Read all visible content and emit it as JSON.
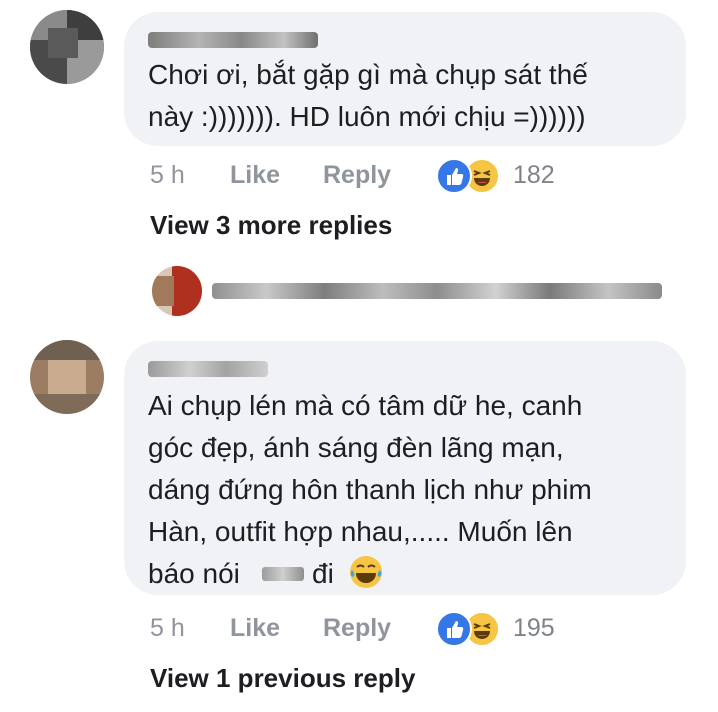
{
  "comment1": {
    "text_line1": "Chơi ơi, bắt gặp gì mà chụp sát thế",
    "text_line2": "này :))))))). HD luôn mới chịu =))))))",
    "time": "5 h",
    "like_label": "Like",
    "reply_label": "Reply",
    "reaction_count": "182",
    "view_replies": "View 3 more replies"
  },
  "comment2": {
    "text_line1": "Ai chụp lén mà có tâm dữ he, canh",
    "text_line2": "góc đẹp, ánh sáng đèn lãng mạn,",
    "text_line3": "dáng đứng hôn thanh lịch như phim",
    "text_line4": "Hàn, outfit hợp nhau,..... Muốn lên",
    "text_line5a": "báo nói",
    "text_line5b": "đi",
    "time": "5 h",
    "like_label": "Like",
    "reply_label": "Reply",
    "reaction_count": "195",
    "view_replies": "View 1 previous reply"
  },
  "colors": {
    "bubble": "#f0f2f5",
    "like_blue": "#3578e5",
    "haha_yellow": "#f7c544",
    "meta_gray": "#90949c"
  },
  "icons": [
    "like-reaction-icon",
    "haha-reaction-icon",
    "laughing-tears-emoji"
  ]
}
